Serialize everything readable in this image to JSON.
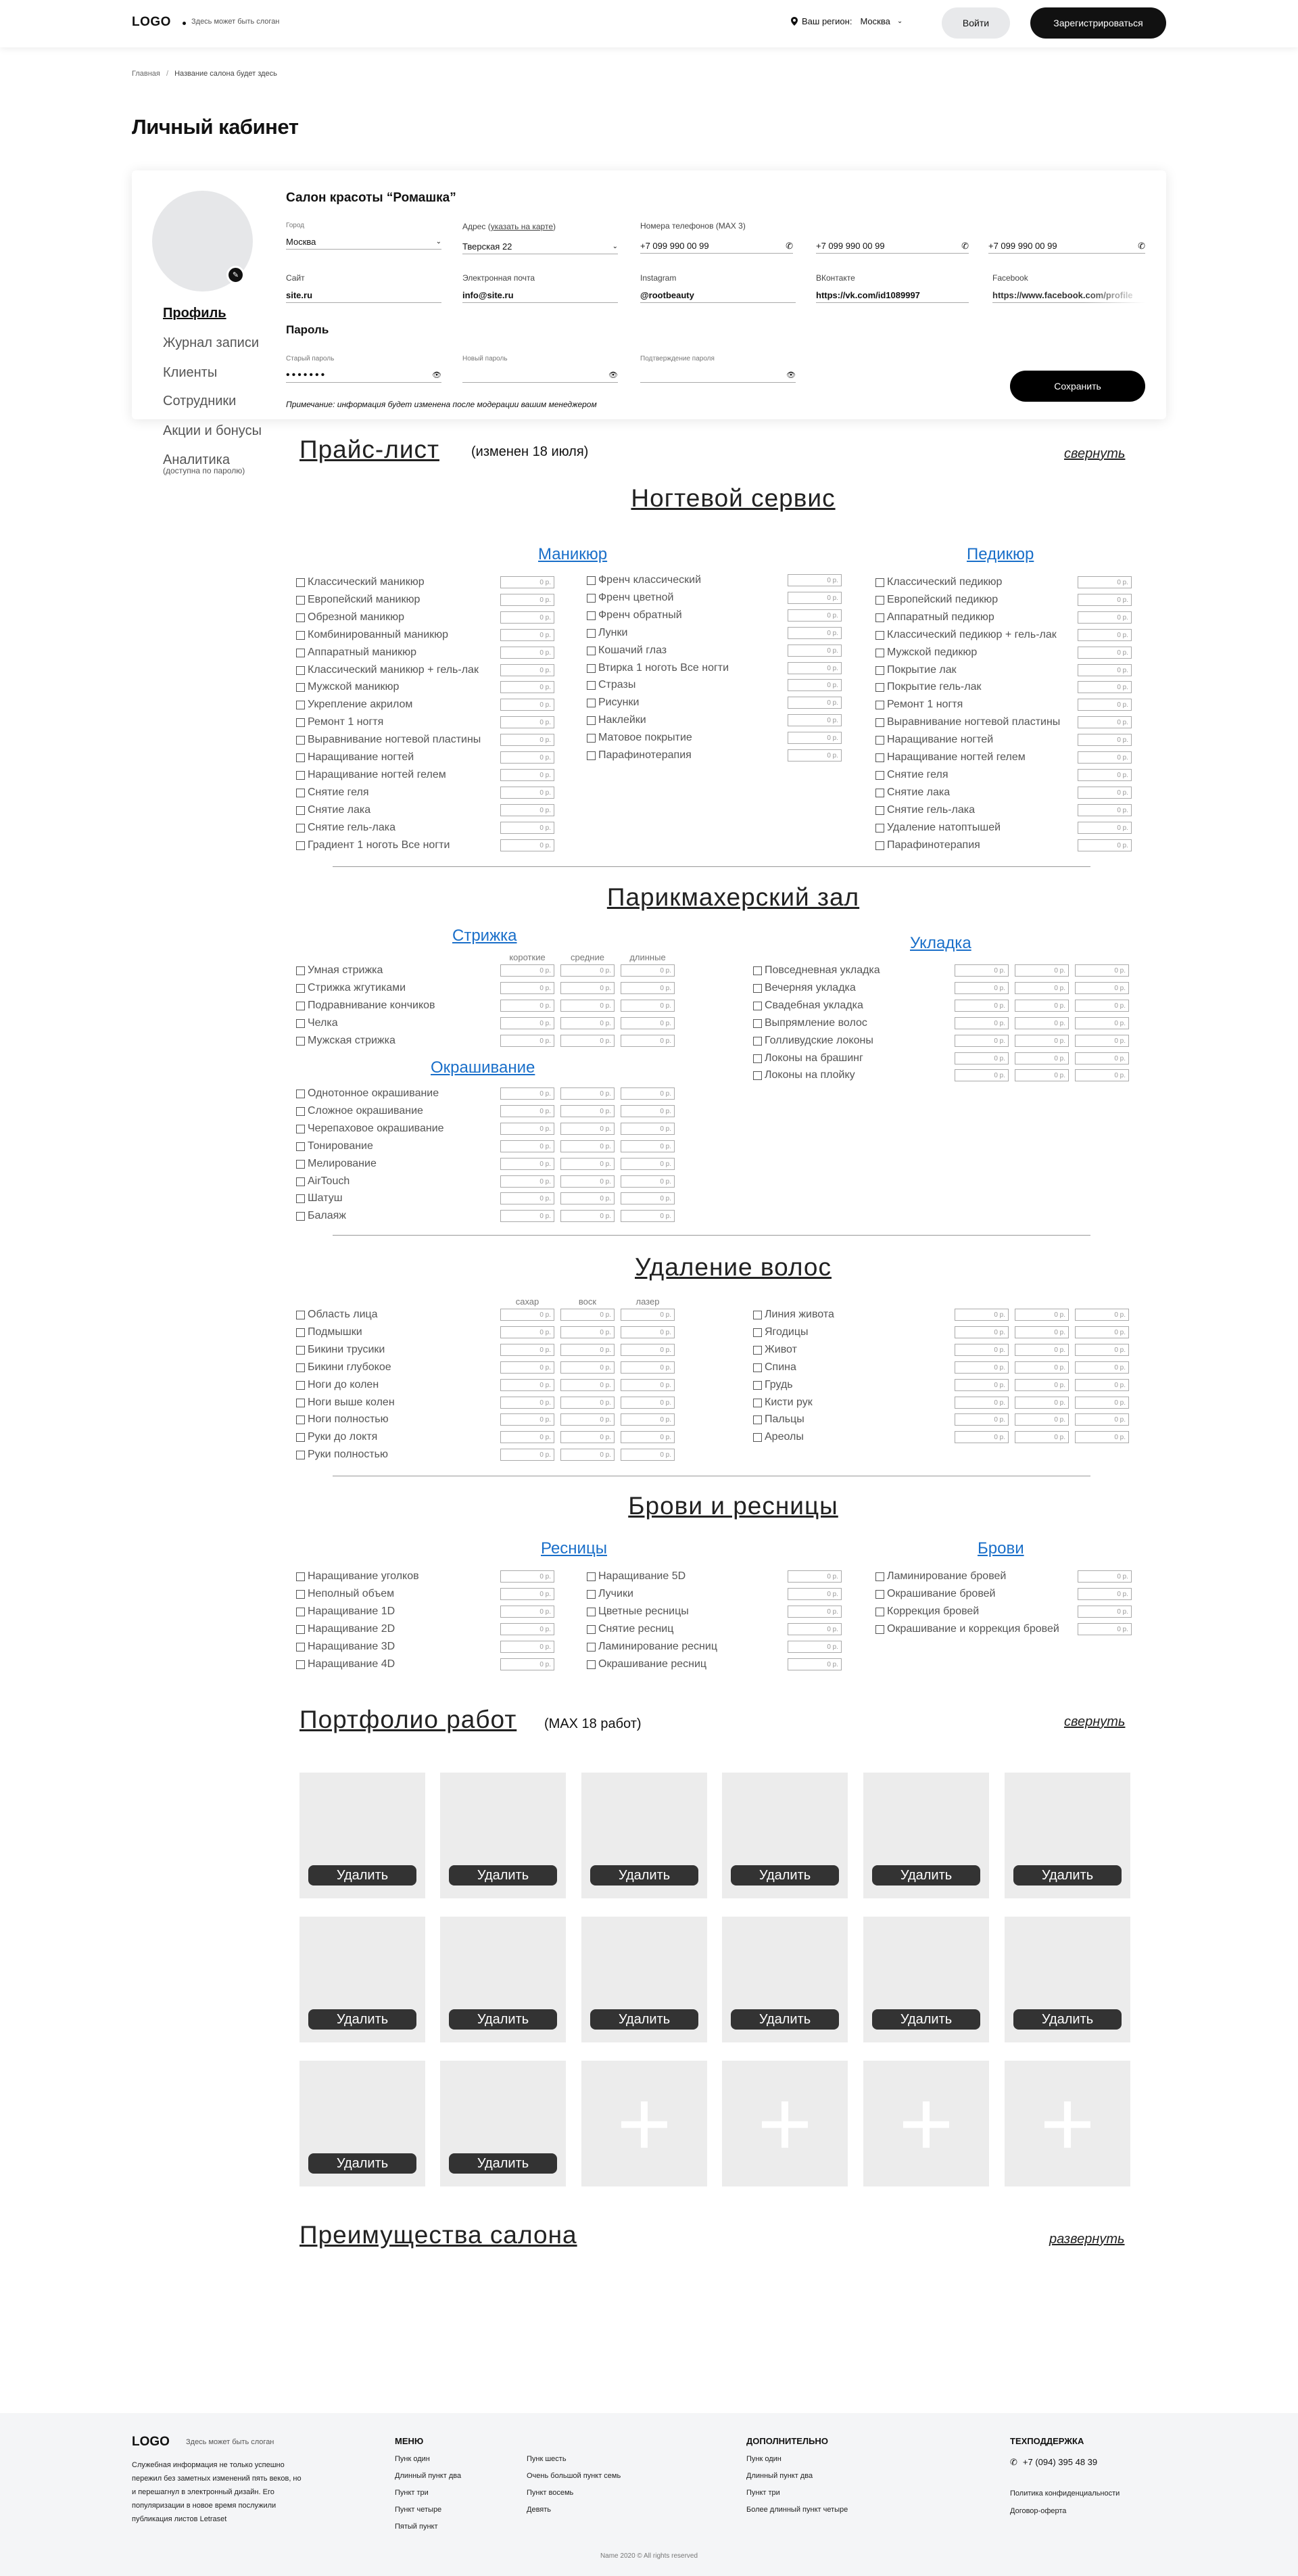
{
  "header": {
    "logo": "LOGO",
    "slogan": "Здесь может быть слоган",
    "region_label": "Ваш регион:",
    "region_value": "Москва",
    "login": "Войти",
    "register": "Зарегистрироваться"
  },
  "breadcrumbs": {
    "home": "Главная",
    "sep": "/",
    "current": "Название салона будет здесь"
  },
  "page_title": "Личный кабинет",
  "side_nav": [
    {
      "label": "Профиль"
    },
    {
      "label": "Журнал записи"
    },
    {
      "label": "Клиенты"
    },
    {
      "label": "Сотрудники"
    },
    {
      "label": "Акции и бонусы"
    },
    {
      "label": "Аналитика",
      "note": "(доступна по паролю)"
    }
  ],
  "profile": {
    "salon_name": "Салон красоты “Ромашка”",
    "city_label": "Город",
    "city": "Москва",
    "address_label": "Адрес (",
    "address_link": "указать на карте",
    "address_close": ")",
    "address": "Тверская 22",
    "phones_label": "Номера телефонов (MAX 3)",
    "phones": [
      "+7 099 990 00 99",
      "+7 099 990 00 99",
      "+7 099 990 00 99"
    ],
    "site_label": "Сайт",
    "site": "site.ru",
    "email_label": "Электронная почта",
    "email": "info@site.ru",
    "instagram_label": "Instagram",
    "instagram": "@rootbeauty",
    "vk_label": "ВКонтакте",
    "vk": "https://vk.com/id1089997",
    "facebook_label": "Facebook",
    "facebook": "https://www.facebook.com/profile",
    "password_title": "Пароль",
    "old_pw_label": "Старый пароль",
    "old_pw": "•••••••",
    "new_pw_label": "Новый пароль",
    "confirm_pw_label": "Подтверждение пароля",
    "note": "Примечание: информация будет изменена после модерации вашим менеджером",
    "save": "Сохранить"
  },
  "price_list": {
    "title": "Прайс-лист",
    "changed": "(изменен 18 июля)",
    "collapse": "свернуть",
    "price_placeholder": "0 р."
  },
  "nail": {
    "title": "Ногтевой сервис",
    "manicure": {
      "title": "Маникюр",
      "items": [
        "Классический маникюр",
        "Европейский маникюр",
        "Обрезной маникюр",
        "Комбинированный маникюр",
        "Аппаратный маникюр",
        "Классический маникюр + гель-лак",
        "Мужской маникюр",
        "Укрепление акрилом",
        "Ремонт 1 ногтя",
        "Выравнивание ногтевой пластины",
        "Наращивание ногтей",
        "Наращивание ногтей гелем",
        "Снятие геля",
        "Снятие лака",
        "Снятие гель-лака",
        "Градиент 1 ноготь Все ногти"
      ]
    },
    "manicure2": {
      "items": [
        "Френч классический",
        "Френч цветной",
        "Френч обратный",
        "Лунки",
        "Кошачий глаз",
        "Втирка 1 ноготь Все ногти",
        "Стразы",
        "Рисунки",
        "Наклейки",
        "Матовое покрытие",
        "Парафинотерапия"
      ]
    },
    "pedicure": {
      "title": "Педикюр",
      "items": [
        "Классический педикюр",
        "Европейский педикюр",
        "Аппаратный педикюр",
        "Классический педикюр + гель-лак",
        "Мужской педикюр",
        "Покрытие лак",
        "Покрытие гель-лак",
        "Ремонт 1 ногтя",
        "Выравнивание ногтевой пластины",
        "Наращивание ногтей",
        "Наращивание ногтей гелем",
        "Снятие геля",
        "Снятие лака",
        "Снятие гель-лака",
        "Удаление натоптышей",
        "Парафинотерапия"
      ]
    }
  },
  "hair": {
    "title": "Парикмахерский зал",
    "cols": [
      "короткие",
      "средние",
      "длинные"
    ],
    "haircut": {
      "title": "Стрижка",
      "items": [
        "Умная стрижка",
        "Стрижка жгутиками",
        "Подравнивание кончиков",
        "Челка",
        "Мужская стрижка"
      ]
    },
    "coloring": {
      "title": "Окрашивание",
      "items": [
        "Однотонное окрашивание",
        "Сложное окрашивание",
        "Черепаховое окрашивание",
        "Тонирование",
        "Мелирование",
        "AirTouch",
        "Шатуш",
        "Балаяж"
      ]
    },
    "styling": {
      "title": "Укладка",
      "items": [
        "Повседневная укладка",
        "Вечерняя укладка",
        "Свадебная укладка",
        "Выпрямление волос",
        "Голливудские локоны",
        "Локоны на брашинг",
        "Локоны на плойку"
      ]
    }
  },
  "removal": {
    "title": "Удаление волос",
    "cols": [
      "сахар",
      "воск",
      "лазер"
    ],
    "left": [
      "Область лица",
      "Подмышки",
      "Бикини трусики",
      "Бикини глубокое",
      "Ноги до колен",
      "Ноги выше колен",
      "Ноги полностью",
      "Руки до локтя",
      "Руки полностью"
    ],
    "right": [
      "Линия живота",
      "Ягодицы",
      "Живот",
      "Спина",
      "Грудь",
      "Кисти рук",
      "Пальцы",
      "Ареолы"
    ]
  },
  "brows": {
    "title": "Брови и ресницы",
    "lashes": {
      "title": "Ресницы",
      "items": [
        "Наращивание уголков",
        "Неполный объем",
        "Наращивание 1D",
        "Наращивание 2D",
        "Наращивание 3D",
        "Наращивание 4D"
      ]
    },
    "lashes2": {
      "items": [
        "Наращивание 5D",
        "Лучики",
        "Цветные ресницы",
        "Снятие ресниц",
        "Ламинирование ресниц",
        "Окрашивание ресниц"
      ]
    },
    "brows": {
      "title": "Брови",
      "items": [
        "Ламинирование бровей",
        "Окрашивание бровей",
        "Коррекция бровей",
        "Окрашивание и коррекция бровей"
      ]
    }
  },
  "portfolio": {
    "title": "Портфолио работ",
    "max": "(MAX 18 работ)",
    "collapse": "свернуть",
    "delete": "Удалить",
    "add": "+",
    "filled": 14,
    "total": 18
  },
  "advantages": {
    "title": "Преимущества салона",
    "expand": "развернуть"
  },
  "footer": {
    "logo": "LOGO",
    "slogan": "Здесь может быть слоган",
    "text": [
      "Служебная информация не только успешно",
      "пережил без заметных изменений пять веков, но",
      "и перешагнул в электронный дизайн. Его",
      "популяризации в новое время послужили",
      "публикация листов Letraset"
    ],
    "menu_title": "МЕНЮ",
    "menu_col1": [
      "Пунк один",
      "Длинный пункт два",
      "Пункт три",
      "Пункт четыре",
      "Пятый пункт"
    ],
    "menu_col2": [
      "Пунк шесть",
      "Очень большой пункт семь",
      "Пункт восемь",
      "Девять"
    ],
    "extra_title": "ДОПОЛНИТЕЛЬНО",
    "extra": [
      "Пунк один",
      "Длинный пункт два",
      "Пункт три",
      "Более длинный пункт четыре"
    ],
    "support_title": "ТЕХПОДДЕРЖКА",
    "phone": "+7 (094) 395 48 39",
    "links": [
      "Политика конфиденциальности",
      "Договор-оферта"
    ],
    "copyright": "Name 2020 © All rights reserved"
  }
}
